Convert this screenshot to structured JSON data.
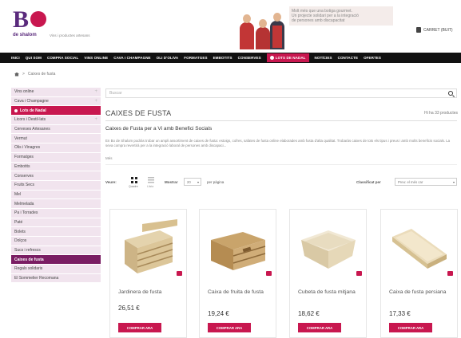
{
  "header": {
    "logo_letter": "B",
    "logo_sub": "de shalom",
    "tagline": "Vins i productes artesans",
    "promo_line1": "Molt més que una botiga gourmet.",
    "promo_line2": "Un projecte solidari per a la integració",
    "promo_line3": "de persones amb discapacitat",
    "cart_label": "CARRET (BUIT)"
  },
  "nav": {
    "items": [
      "INICI",
      "QUI SOM",
      "COMPRA SOCIAL",
      "VINS ONLINE",
      "CAVA I CHAMPAGNE",
      "OLI D'OLIVA",
      "FORMATGES",
      "EMBOTITS",
      "CONSERVES",
      "LOTS DE NADAL",
      "NOTÍCIES",
      "CONTACTE",
      "OFERTES"
    ],
    "active_index": 9
  },
  "breadcrumb": {
    "current": "Caixes de fusta"
  },
  "sidebar": {
    "items": [
      {
        "label": "Vins online",
        "plus": "+"
      },
      {
        "label": "Cava i Champagne",
        "plus": "+"
      },
      {
        "label": "Lots de Nadal",
        "plus": ""
      },
      {
        "label": "Licors i Destil·lats",
        "plus": "+"
      },
      {
        "label": "Cerveses Artesanes",
        "plus": ""
      },
      {
        "label": "Vermut",
        "plus": ""
      },
      {
        "label": "Olis i Vinagres",
        "plus": ""
      },
      {
        "label": "Formatges",
        "plus": ""
      },
      {
        "label": "Embotits",
        "plus": ""
      },
      {
        "label": "Conserves",
        "plus": ""
      },
      {
        "label": "Fruits Secs",
        "plus": ""
      },
      {
        "label": "Mel",
        "plus": ""
      },
      {
        "label": "Melmelada",
        "plus": ""
      },
      {
        "label": "Pa i Torrades",
        "plus": ""
      },
      {
        "label": "Paté",
        "plus": ""
      },
      {
        "label": "Bolets",
        "plus": ""
      },
      {
        "label": "Dolços",
        "plus": ""
      },
      {
        "label": "Sucs i refrescs",
        "plus": ""
      },
      {
        "label": "Caixes de fusta",
        "plus": ""
      },
      {
        "label": "Regals solidaris",
        "plus": ""
      },
      {
        "label": "El Sommelier Recomana",
        "plus": ""
      }
    ]
  },
  "search": {
    "placeholder": "Buscar"
  },
  "main": {
    "title": "CAIXES DE FUSTA",
    "count": "Hi ha 33 productes",
    "subtitle": "Caixes de Fusta per a Vi amb Benefici Socials",
    "description_line1": "En Bo de Shalom podràs trobar un ampli assortiment de caixes de fusta: estoigs, cofres, safates de fusta online elaborades amb fusta d'alta qualitat. Trobaràs",
    "description_line2": "caixes de tots els tipus i preus i amb molts beneficis socials. La seva compra revertirà per a la integració laboral de persones amb discapaci...",
    "more_label": "Més"
  },
  "toolbar": {
    "view_label": "Veure:",
    "grid_caption": "Quadre",
    "list_caption": "Llista",
    "show_label": "Mostrar",
    "per_page_value": "20",
    "per_page_suffix": "per pàgina",
    "sort_label": "Classificat per",
    "sort_value": "Preu: el més car"
  },
  "products": [
    {
      "name": "Jardinera de fusta",
      "price": "26,51 €",
      "button": "COMPRAR ARA"
    },
    {
      "name": "Caixa de fruita de fusta",
      "price": "19,24 €",
      "button": "COMPRAR ARA"
    },
    {
      "name": "Cubeta de fusta mitjana",
      "price": "18,62 €",
      "button": "COMPRAR ARA"
    },
    {
      "name": "Caixa de fusta persiana",
      "price": "17,33 €",
      "button": "COMPRAR ARA"
    }
  ],
  "colors": {
    "accent": "#c8174f",
    "purple": "#7a1d63",
    "nav_bg": "#111111",
    "sidebar_bg": "#f1e4ee"
  }
}
